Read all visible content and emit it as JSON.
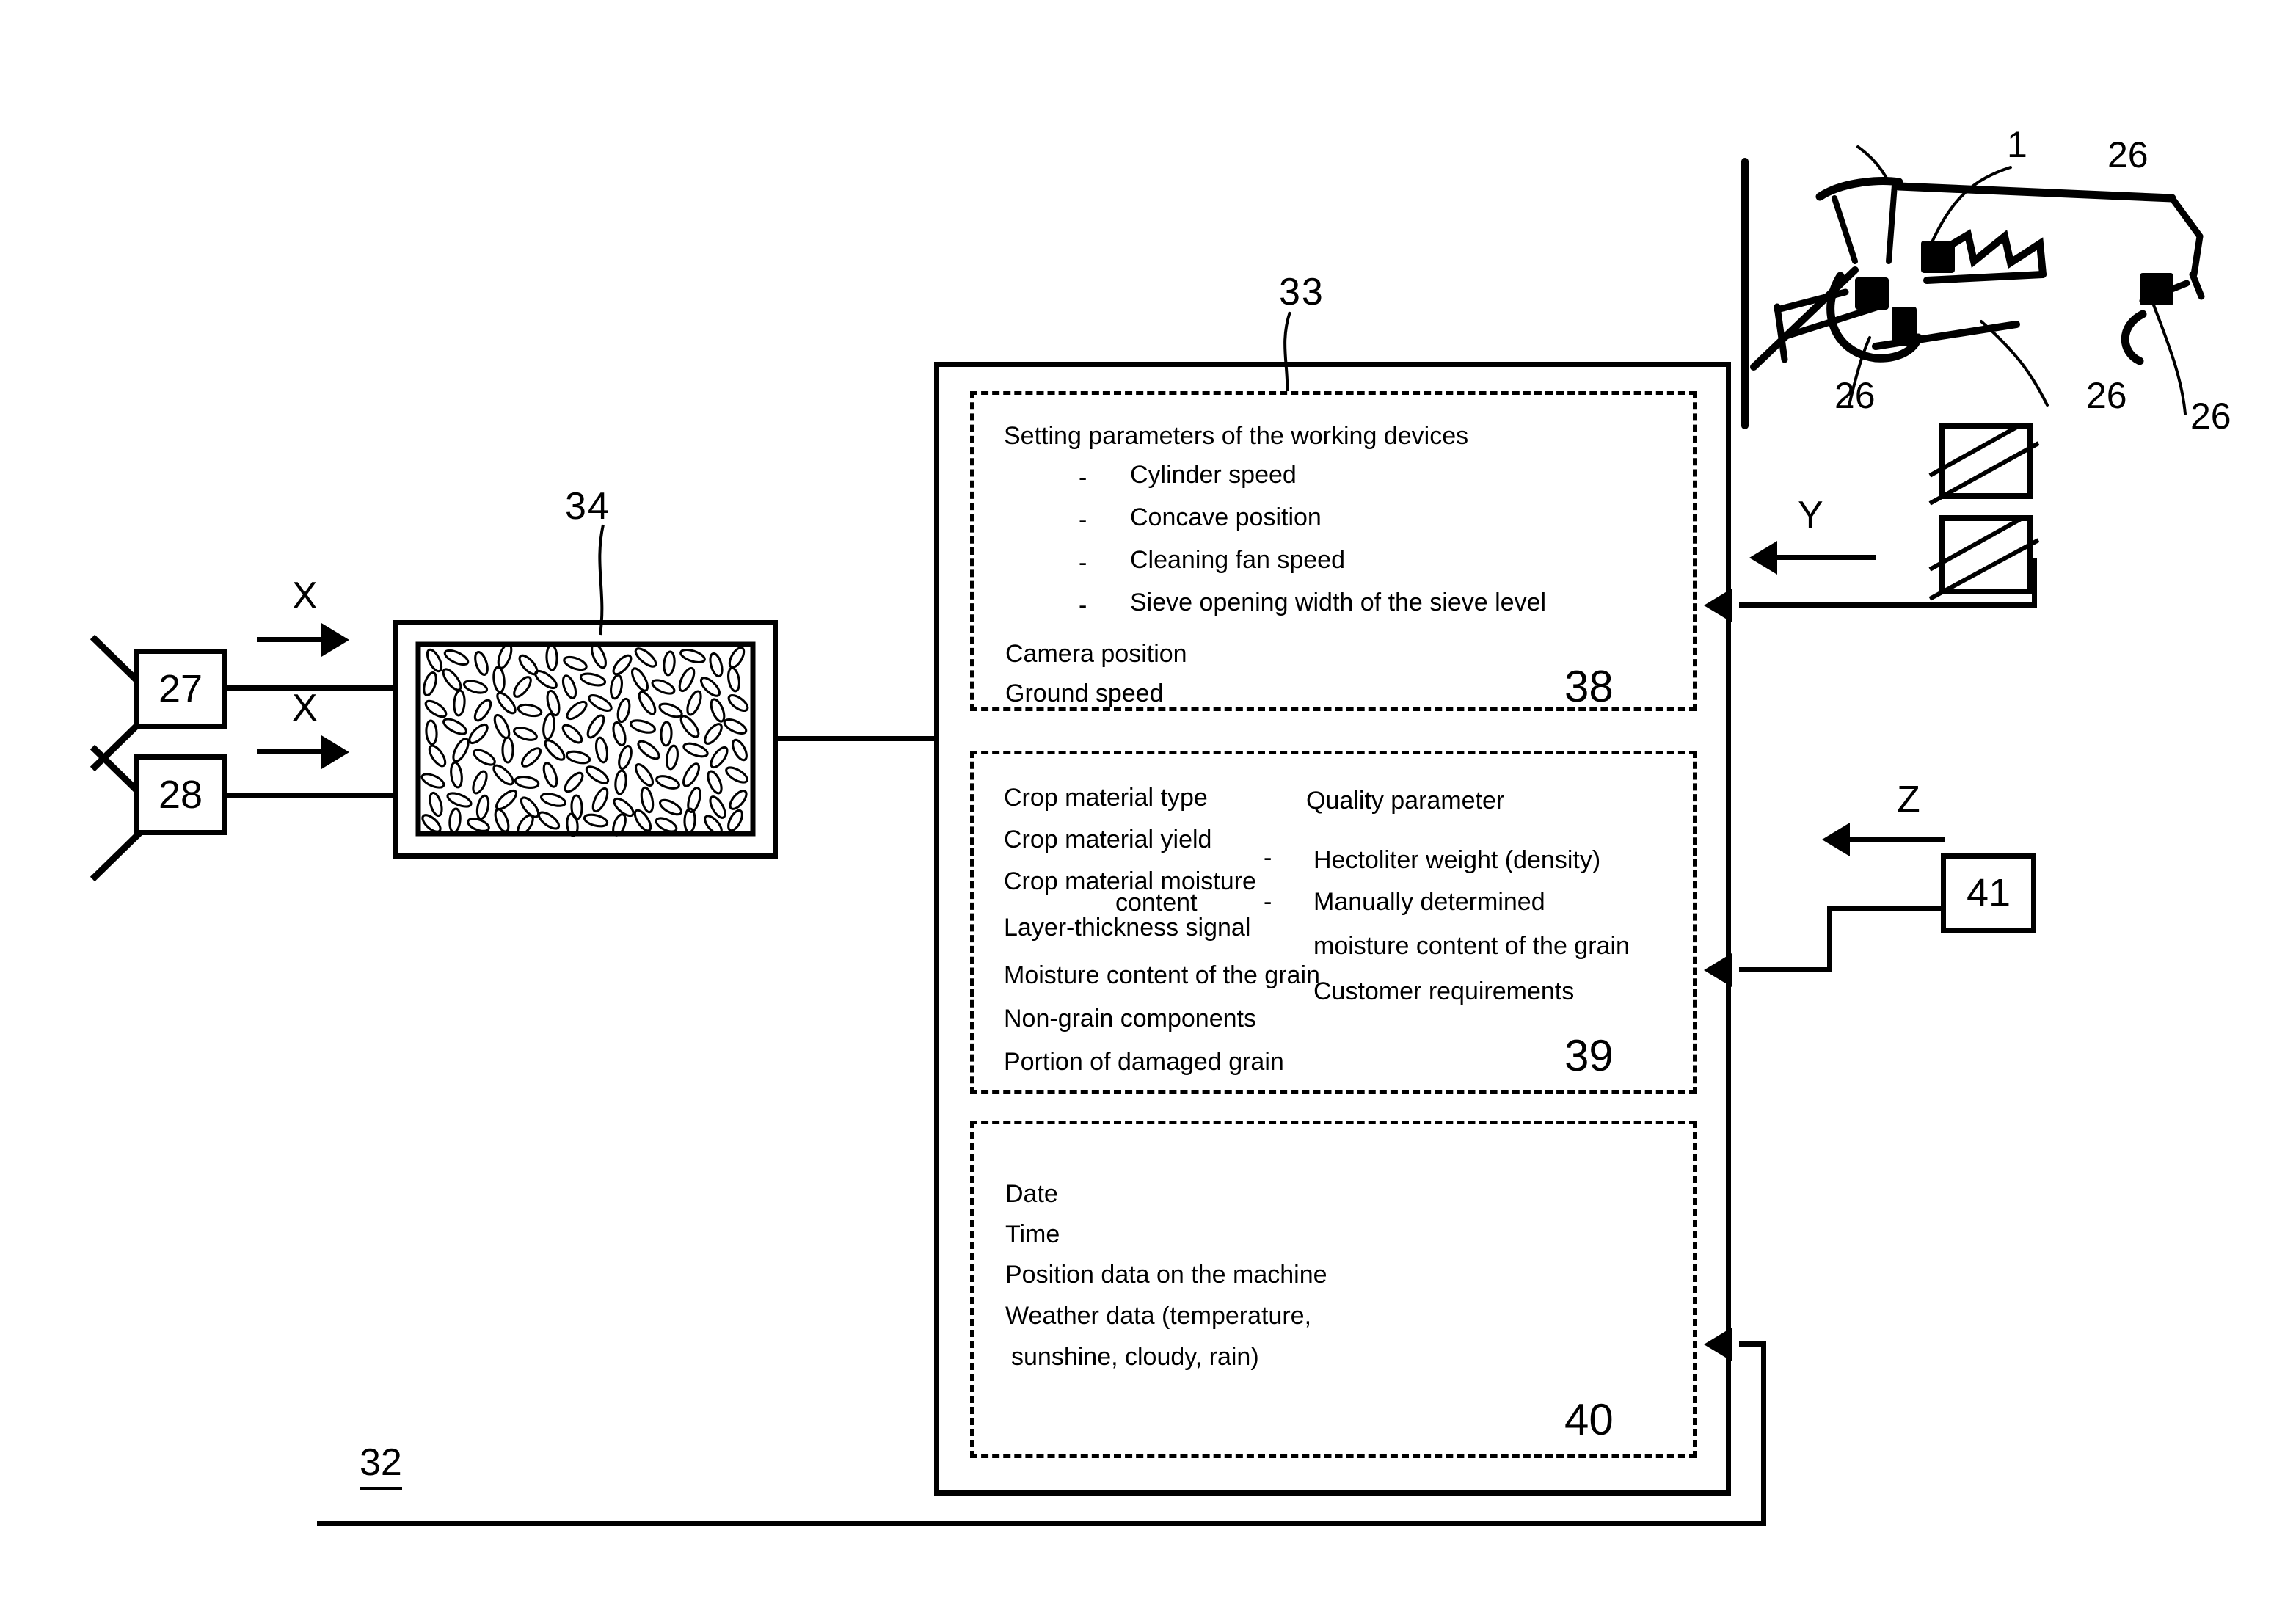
{
  "figure": {
    "reference_numerals": {
      "harvester": "1",
      "working_devices": "26",
      "sensor_a": "27",
      "sensor_b": "28",
      "baseline": "32",
      "data_record": "33",
      "image_block": "34",
      "settings_block": "38",
      "crop_block": "39",
      "meta_block": "40",
      "external_source": "41"
    },
    "flow_labels": {
      "x1": "X",
      "x2": "X",
      "y": "Y",
      "z": "Z"
    },
    "harvester_callouts": [
      "1",
      "26",
      "26",
      "26",
      "26"
    ]
  },
  "settings_block": {
    "id": "38",
    "heading": "Setting parameters of the working devices",
    "bullet_marker": "-",
    "bullets": [
      "Cylinder speed",
      "Concave position",
      "Cleaning fan speed",
      "Sieve opening width of the sieve level"
    ],
    "extras": [
      "Camera position",
      "Ground speed"
    ]
  },
  "crop_block": {
    "id": "39",
    "left_items": [
      "Crop material type",
      "Crop material yield",
      "Crop material moisture",
      "content",
      "Layer-thickness signal",
      "Moisture content of the grain",
      "Non-grain components",
      "Portion of damaged grain"
    ],
    "right_heading": "Quality parameter",
    "bullet_marker": "-",
    "right_items": [
      "Hectoliter weight (density)",
      "Manually determined",
      "moisture content of the grain",
      "Customer requirements"
    ]
  },
  "meta_block": {
    "id": "40",
    "items": [
      "Date",
      "Time",
      "Position data on the machine",
      "Weather data (temperature,",
      "sunshine, cloudy, rain)"
    ]
  },
  "colors": {
    "ink": "#000000",
    "paper": "#ffffff"
  }
}
